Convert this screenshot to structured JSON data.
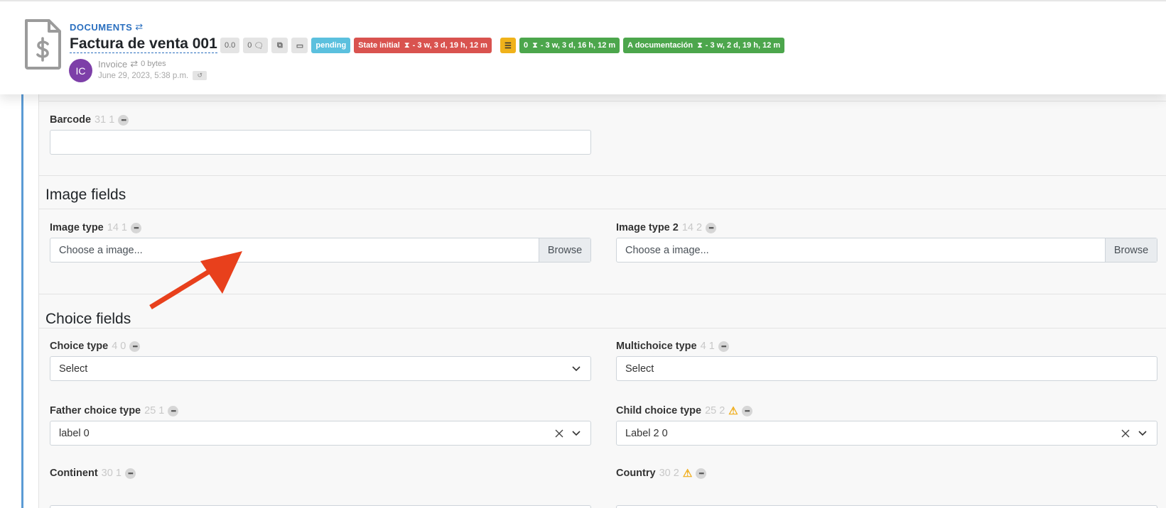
{
  "header": {
    "breadcrumb": "DOCUMENTS",
    "title": "Factura de venta 001",
    "rating": "0.0",
    "comments": "0",
    "badges": {
      "status": "pending",
      "state_label": "State initial",
      "state_time": "- 3 w, 3 d, 19 h, 12 m",
      "tasks_count": "0",
      "tasks_time": "- 3 w, 3 d, 16 h, 12 m",
      "assignment_label": "A documentación",
      "assignment_time": "- 3 w, 2 d, 19 h, 12 m"
    },
    "avatar_initials": "IC",
    "doc_type": "Invoice",
    "doc_size": "0 bytes",
    "date": "June 29, 2023, 5:38 p.m."
  },
  "form": {
    "codes_section": {
      "barcode": {
        "label": "Barcode",
        "meta": "31 1",
        "value": ""
      }
    },
    "image_section": {
      "title": "Image fields",
      "image_type": {
        "label": "Image type",
        "meta": "14 1",
        "placeholder": "Choose a image...",
        "button": "Browse"
      },
      "image_type_2": {
        "label": "Image type 2",
        "meta": "14 2",
        "placeholder": "Choose a image...",
        "button": "Browse"
      }
    },
    "choice_section": {
      "title": "Choice fields",
      "choice_type": {
        "label": "Choice type",
        "meta": "4 0",
        "value": "Select"
      },
      "multichoice_type": {
        "label": "Multichoice type",
        "meta": "4 1",
        "value": "Select"
      },
      "father_choice_type": {
        "label": "Father choice type",
        "meta": "25 1",
        "value": "label 0"
      },
      "child_choice_type": {
        "label": "Child choice type",
        "meta": "25 2",
        "value": "Label 2 0"
      },
      "continent": {
        "label": "Continent",
        "meta": "30 1"
      },
      "country": {
        "label": "Country",
        "meta": "30 2"
      }
    }
  },
  "colors": {
    "accent_blue": "#2a6fbf",
    "badge_blue": "#5bc0de",
    "badge_red": "#d9534f",
    "badge_green": "#4ca64c",
    "badge_yellow": "#f0b21a",
    "avatar_purple": "#7d3fa8",
    "annotation_arrow": "#e8401c"
  },
  "icons": [
    "document-dollar-icon",
    "swap-arrows-icon",
    "comment-icon",
    "copy-icon",
    "folder-icon",
    "hourglass-icon",
    "checklist-icon",
    "history-icon",
    "more-dots-icon",
    "warning-icon",
    "clear-x-icon",
    "chevron-down-icon"
  ]
}
